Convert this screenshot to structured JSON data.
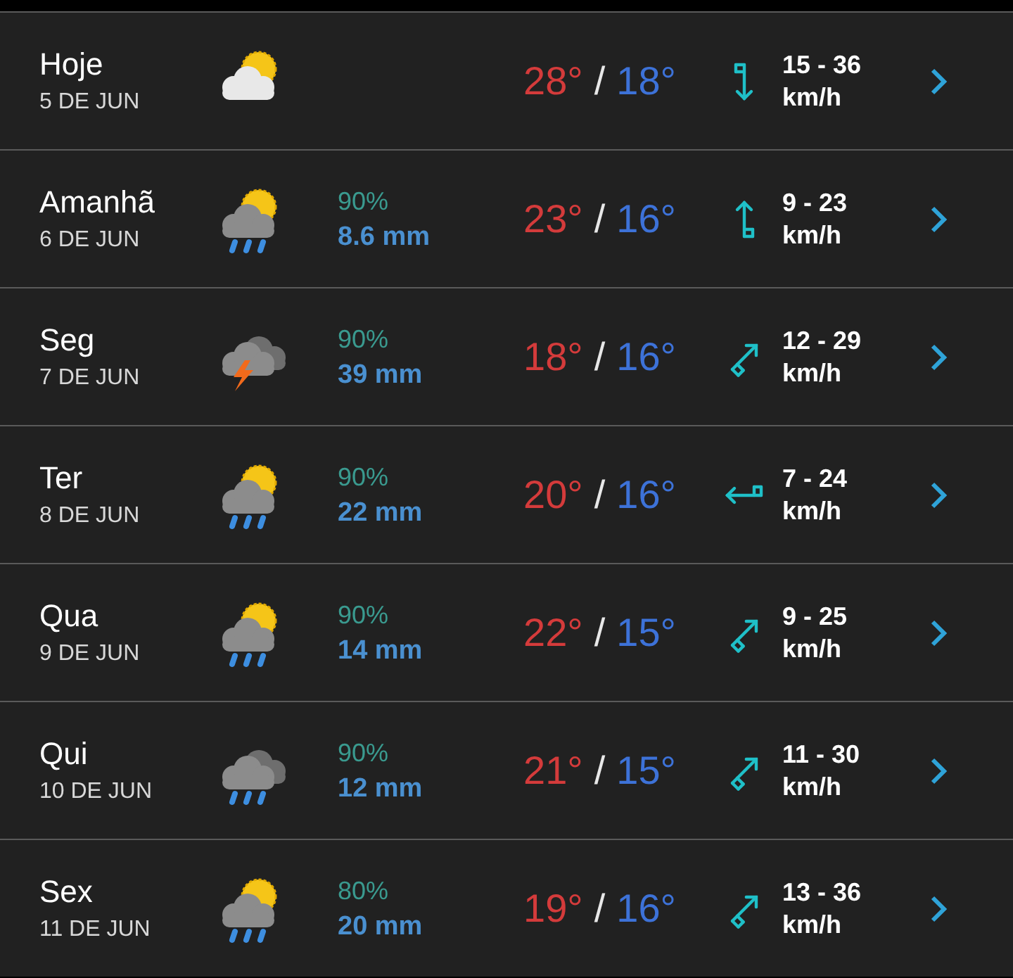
{
  "days": [
    {
      "day": "Hoje",
      "date": "5 DE JUN",
      "icon": {
        "kind": "partly-cloudy"
      },
      "high": "28°",
      "separator": "/",
      "low": "18°",
      "wind_arrow": {
        "kind": "south"
      },
      "wind": "15 - 36",
      "wind_unit": "km/h"
    },
    {
      "day": "Amanhã",
      "date": "6 DE JUN",
      "icon": {
        "kind": "sunrain"
      },
      "chance": "90%",
      "amount": "8.6 mm",
      "high": "23°",
      "separator": "/",
      "low": "16°",
      "wind_arrow": {
        "kind": "north"
      },
      "wind": "9 - 23",
      "wind_unit": "km/h"
    },
    {
      "day": "Seg",
      "date": "7 DE JUN",
      "icon": {
        "kind": "thunder"
      },
      "chance": "90%",
      "amount": "39 mm",
      "high": "18°",
      "separator": "/",
      "low": "16°",
      "wind_arrow": {
        "kind": "northeast"
      },
      "wind": "12 - 29",
      "wind_unit": "km/h"
    },
    {
      "day": "Ter",
      "date": "8 DE JUN",
      "icon": {
        "kind": "sunrain"
      },
      "chance": "90%",
      "amount": "22 mm",
      "high": "20°",
      "separator": "/",
      "low": "16°",
      "wind_arrow": {
        "kind": "west"
      },
      "wind": "7 - 24",
      "wind_unit": "km/h"
    },
    {
      "day": "Qua",
      "date": "9 DE JUN",
      "icon": {
        "kind": "sunrain"
      },
      "chance": "90%",
      "amount": "14 mm",
      "high": "22°",
      "separator": "/",
      "low": "15°",
      "wind_arrow": {
        "kind": "northeast"
      },
      "wind": "9 - 25",
      "wind_unit": "km/h"
    },
    {
      "day": "Qui",
      "date": "10 DE JUN",
      "icon": {
        "kind": "rain"
      },
      "chance": "90%",
      "amount": "12 mm",
      "high": "21°",
      "separator": "/",
      "low": "15°",
      "wind_arrow": {
        "kind": "northeast"
      },
      "wind": "11 - 30",
      "wind_unit": "km/h"
    },
    {
      "day": "Sex",
      "date": "11 DE JUN",
      "icon": {
        "kind": "sunrain"
      },
      "chance": "80%",
      "amount": "20 mm",
      "high": "19°",
      "separator": "/",
      "low": "16°",
      "wind_arrow": {
        "kind": "northeast"
      },
      "wind": "13 - 36",
      "wind_unit": "km/h"
    }
  ]
}
